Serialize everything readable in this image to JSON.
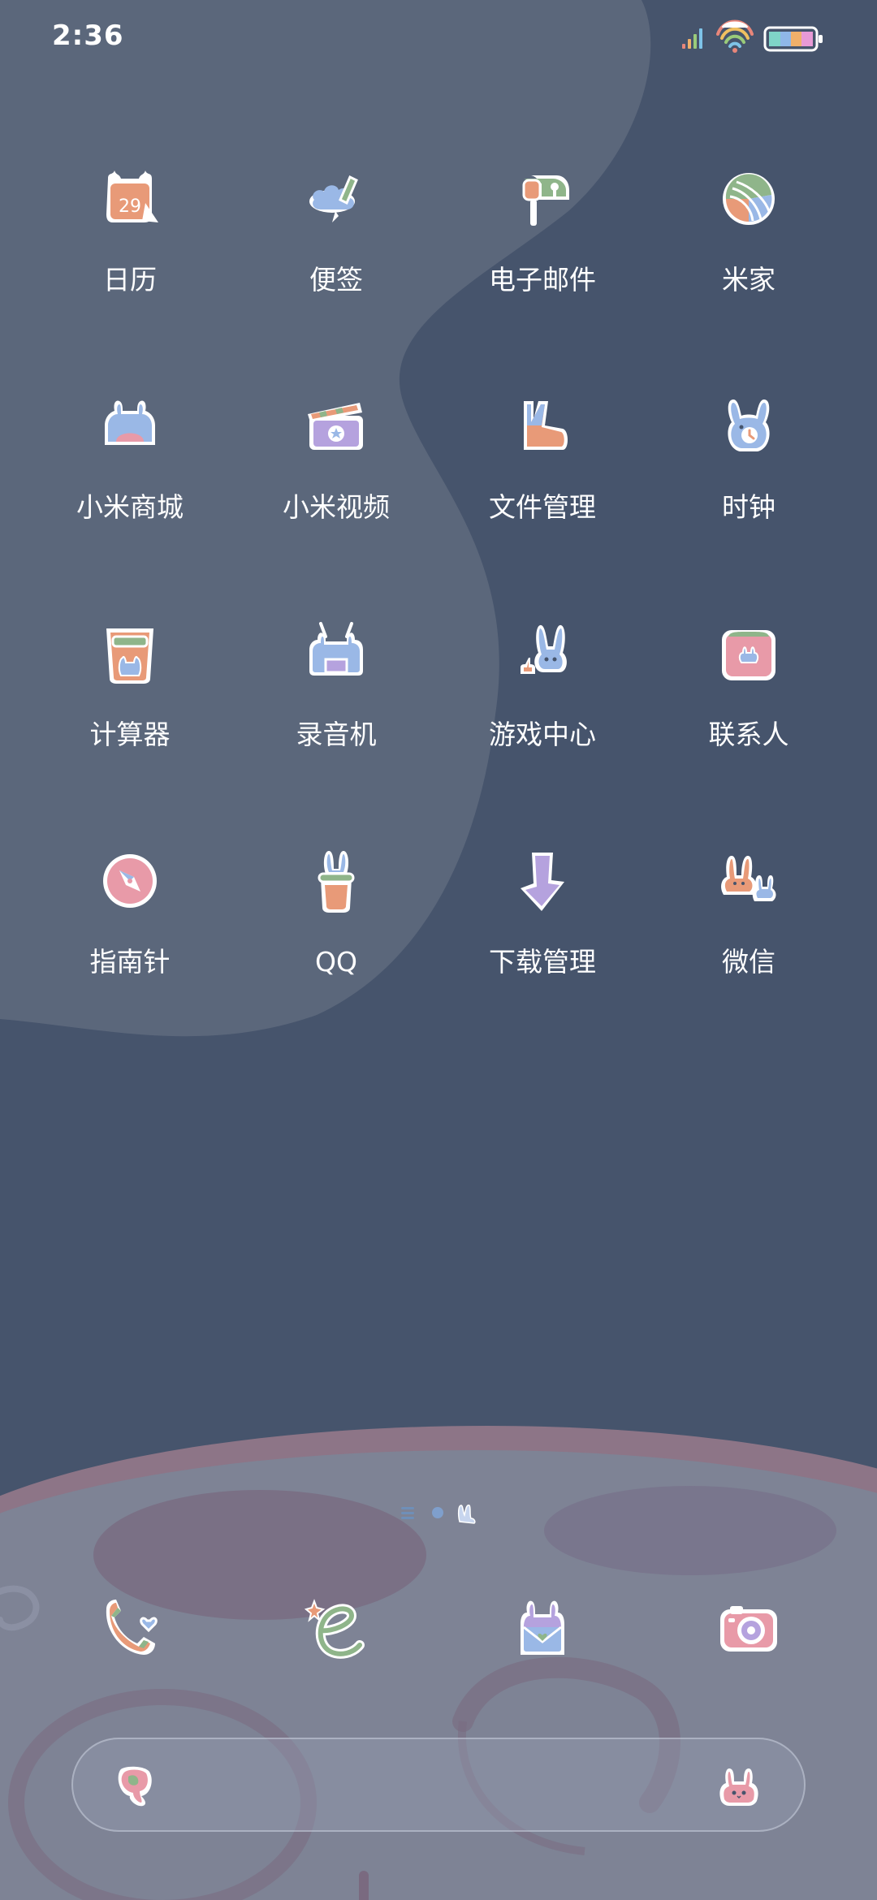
{
  "status_bar": {
    "time": "2:36",
    "icons": [
      "signal-bars-icon",
      "wifi-rainbow-icon",
      "battery-icon"
    ]
  },
  "search": {
    "placeholder": "",
    "left_icon": "search-bunny-icon",
    "right_icon": "bunny-face-icon"
  },
  "apps": [
    {
      "label": "日历",
      "icon": "calendar-icon",
      "day": "29"
    },
    {
      "label": "便签",
      "icon": "notes-icon"
    },
    {
      "label": "电子邮件",
      "icon": "mailbox-icon"
    },
    {
      "label": "米家",
      "icon": "yarn-ball-icon"
    },
    {
      "label": "小米商城",
      "icon": "store-bunny-icon"
    },
    {
      "label": "小米视频",
      "icon": "clapperboard-icon"
    },
    {
      "label": "文件管理",
      "icon": "file-boot-icon"
    },
    {
      "label": "时钟",
      "icon": "clock-bunny-icon"
    },
    {
      "label": "计算器",
      "icon": "calculator-cup-icon"
    },
    {
      "label": "录音机",
      "icon": "recorder-tv-icon"
    },
    {
      "label": "游戏中心",
      "icon": "game-bunny-icon"
    },
    {
      "label": "联系人",
      "icon": "contacts-bunny-icon"
    },
    {
      "label": "指南针",
      "icon": "compass-icon"
    },
    {
      "label": "QQ",
      "icon": "magic-hat-bunny-icon"
    },
    {
      "label": "下载管理",
      "icon": "download-arrow-icon"
    },
    {
      "label": "微信",
      "icon": "two-bunnies-icon"
    }
  ],
  "dock": [
    {
      "icon": "phone-heart-icon"
    },
    {
      "icon": "browser-e-icon"
    },
    {
      "icon": "messages-bunny-icon"
    },
    {
      "icon": "camera-icon"
    }
  ],
  "page_indicator": {
    "pages": 3,
    "current": 1
  },
  "colors": {
    "background_dark": "#46546c",
    "background_blob": "#5b677b",
    "planet": "#7d8294",
    "planet_rim": "#8e7488",
    "label": "#ffffff",
    "icon_orange": "#e89a78",
    "icon_blue": "#9ab8e6",
    "icon_green": "#8fb58a",
    "icon_pink": "#e89aa8",
    "icon_purple": "#b5a2de"
  }
}
